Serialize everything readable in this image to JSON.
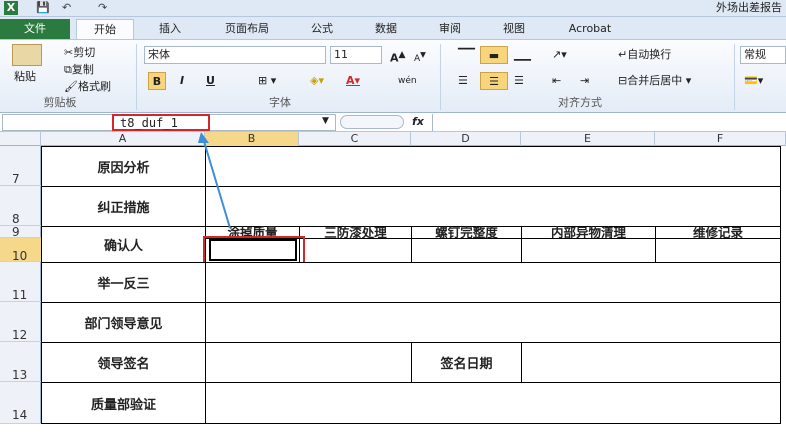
{
  "title": "外场出差报告",
  "quick_access": [
    "X",
    "💾",
    "↶",
    "↷"
  ],
  "tabs": [
    "文件",
    "开始",
    "插入",
    "页面布局",
    "公式",
    "数据",
    "审阅",
    "视图",
    "Acrobat"
  ],
  "clipboard": {
    "paste": "粘贴",
    "cut": "剪切",
    "copy": "复制",
    "format_painter": "格式刷",
    "label": "剪贴板"
  },
  "font": {
    "name": "宋体",
    "size": "11",
    "label": "字体",
    "bold": "B",
    "italic": "I",
    "underline": "U",
    "phonetic": "wén"
  },
  "alignment": {
    "wrap": "自动换行",
    "merge": "合并后居中",
    "label": "对齐方式"
  },
  "number": {
    "format": "常规"
  },
  "name_box": "t8_duf_1",
  "fx": "fx",
  "columns": [
    "A",
    "B",
    "C",
    "D",
    "E",
    "F"
  ],
  "rows": [
    "7",
    "8",
    "9",
    "10",
    "11",
    "12",
    "13",
    "14"
  ],
  "sheet": {
    "r7": "原因分析",
    "r8": "纠正措施",
    "r9_10_label": "确认人",
    "headers": [
      "涂掉质量",
      "三防漆处理",
      "螺钉完整度",
      "内部异物清理",
      "维修记录"
    ],
    "r11": "举一反三",
    "r12": "部门领导意见",
    "r13": "领导签名",
    "r13_date": "签名日期",
    "r14": "质量部验证"
  },
  "accent_color": "#d6262a"
}
